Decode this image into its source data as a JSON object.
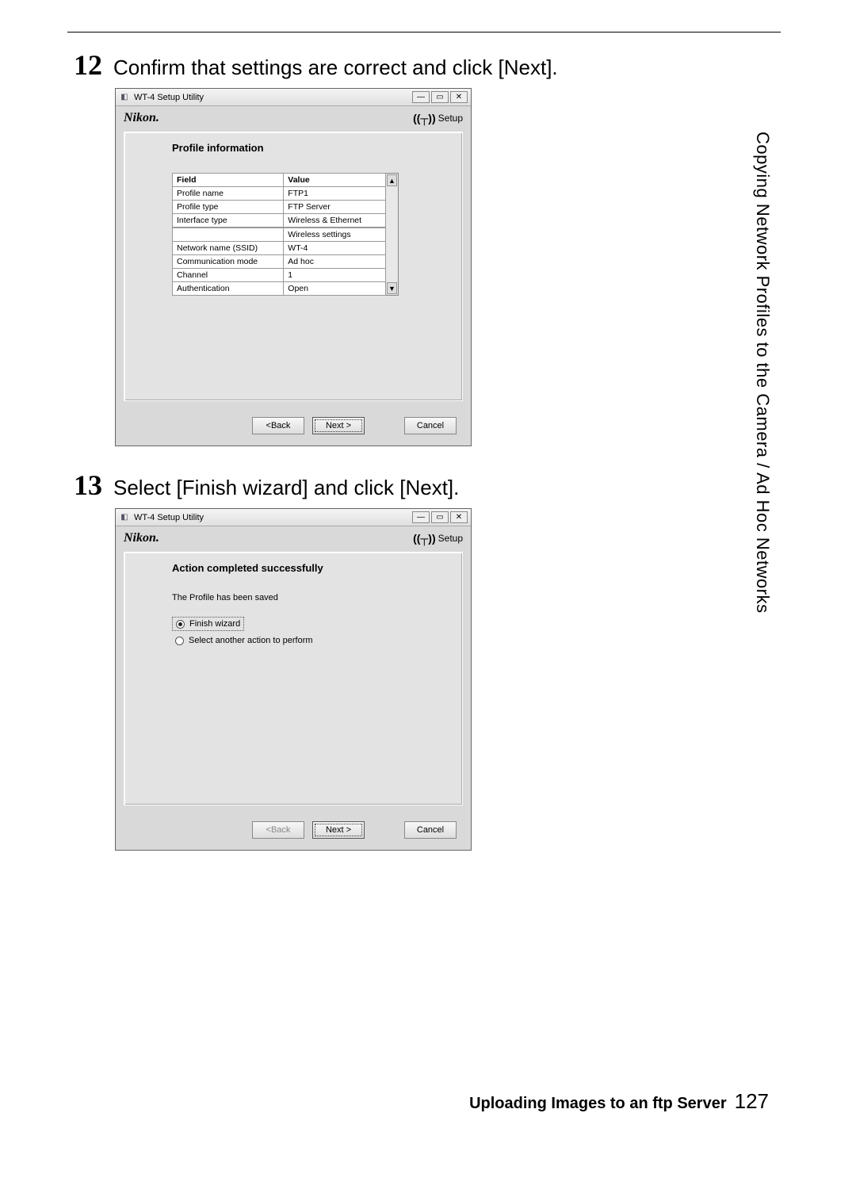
{
  "sidebar_text": "Copying Network Profiles to the Camera / Ad Hoc Networks",
  "step12": {
    "num": "12",
    "text": "Confirm that settings are correct and click [Next].",
    "dialog": {
      "title": "WT-4 Setup Utility",
      "brand": "Nikon.",
      "setup_label": "Setup",
      "section": "Profile information",
      "headers": {
        "field": "Field",
        "value": "Value"
      },
      "rows": [
        {
          "field": "Profile name",
          "value": "FTP1"
        },
        {
          "field": "Profile type",
          "value": "FTP Server"
        },
        {
          "field": "Interface type",
          "value": "Wireless & Ethernet"
        }
      ],
      "subheader": "Wireless settings",
      "rows2": [
        {
          "field": "Network name (SSID)",
          "value": "WT-4"
        },
        {
          "field": "Communication mode",
          "value": "Ad hoc"
        },
        {
          "field": "Channel",
          "value": "1"
        },
        {
          "field": "Authentication",
          "value": "Open"
        }
      ],
      "buttons": {
        "back": "<Back",
        "next": "Next >",
        "cancel": "Cancel"
      }
    }
  },
  "step13": {
    "num": "13",
    "text": "Select [Finish wizard] and click [Next].",
    "dialog": {
      "title": "WT-4 Setup Utility",
      "brand": "Nikon.",
      "setup_label": "Setup",
      "section": "Action completed successfully",
      "message": "The Profile has been saved",
      "radio1": "Finish wizard",
      "radio2": "Select another action to perform",
      "buttons": {
        "back": "<Back",
        "next": "Next >",
        "cancel": "Cancel"
      }
    }
  },
  "footer": {
    "title": "Uploading Images to an ftp Server",
    "page": "127"
  }
}
